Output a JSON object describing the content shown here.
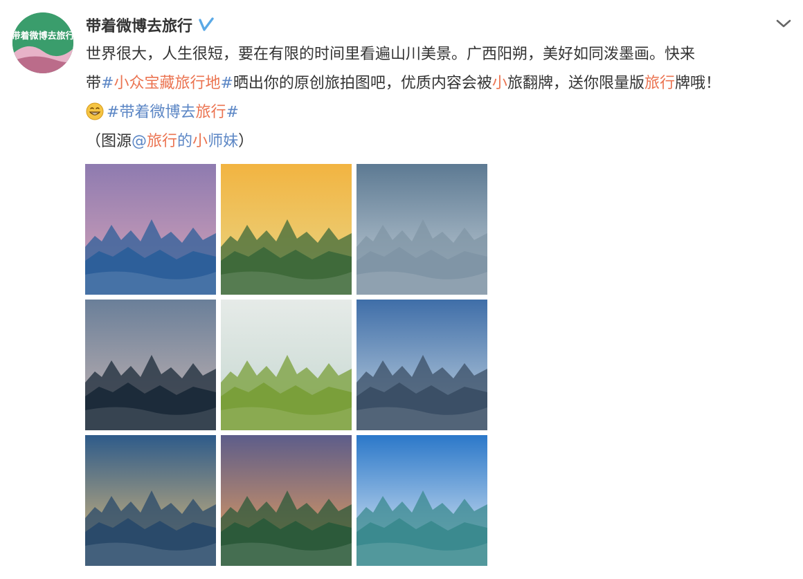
{
  "post": {
    "username": "带着微博去旅行",
    "avatar_text": "#带着微博去旅行#",
    "verified_icon": "verified-badge-icon",
    "menu_icon": "chevron-down-icon",
    "text": {
      "line1": "世界很大，人生很短，要在有限的时间里看遍山川美景。广西阳朔，美好如同泼墨画。快来",
      "line2_a": "带",
      "line2_hash_open": "#",
      "line2_topic": "小众宝藏旅行地",
      "line2_hash_close": "#",
      "line2_b": "晒出你的原创旅拍图吧，优质内容会被",
      "line2_small": "小",
      "line2_c": "旅翻牌，送你限量版",
      "line2_travel": "旅行",
      "line2_d": "牌哦！",
      "line3_hash_open": "#",
      "line3_topic_a": "带着微博去",
      "line3_topic_b": "旅行",
      "line3_hash_close": "#",
      "line4_a": "（图源",
      "line4_at": "@",
      "line4_name_a": "旅行",
      "line4_name_b": "的",
      "line4_name_c": "小",
      "line4_name_d": "师妹",
      "line4_b": "）"
    }
  },
  "photos": [
    {
      "name": "purple-dusk-karst-mountains",
      "sky_top": "#8e7bb0",
      "sky_bottom": "#d9a5b8",
      "ground": "#2d5f9a"
    },
    {
      "name": "sunset-river-valley-aerial",
      "sky_top": "#f2b441",
      "sky_bottom": "#e8d88a",
      "ground": "#3f6a3a"
    },
    {
      "name": "cloud-sea-over-town",
      "sky_top": "#5d7a93",
      "sky_bottom": "#c8d3db",
      "ground": "#8095a6"
    },
    {
      "name": "fisherman-lantern-lake",
      "sky_top": "#6a7f99",
      "sky_bottom": "#c9b7b4",
      "ground": "#1c2b3a"
    },
    {
      "name": "misty-canola-field",
      "sky_top": "#e6ebe8",
      "sky_bottom": "#c3d6cf",
      "ground": "#7a9f3a"
    },
    {
      "name": "blue-hour-rocky-shore",
      "sky_top": "#3f6ea8",
      "sky_bottom": "#c8d8e4",
      "ground": "#3b4f66"
    },
    {
      "name": "sunrise-valley-village",
      "sky_top": "#2e5b8a",
      "sky_bottom": "#e7c17a",
      "ground": "#2a4a6a"
    },
    {
      "name": "river-bend-sunset",
      "sky_top": "#5d5d8a",
      "sky_bottom": "#f0a35a",
      "ground": "#2c5a3a"
    },
    {
      "name": "blue-sky-li-river",
      "sky_top": "#2b78c9",
      "sky_bottom": "#e9f1f7",
      "ground": "#3b8a8f"
    }
  ]
}
